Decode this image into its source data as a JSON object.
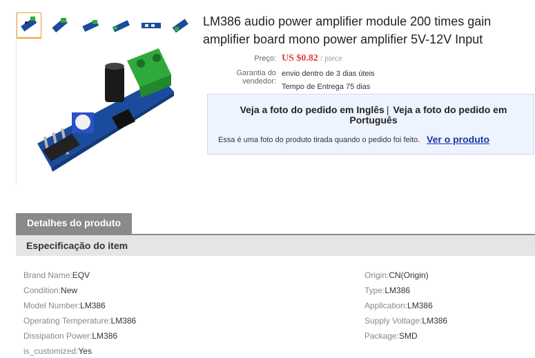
{
  "product": {
    "title": "LM386 audio power amplifier module 200 times gain amplifier board mono power amplifier 5V-12V Input"
  },
  "pricing": {
    "label": "Preço:",
    "price": "US $0.82",
    "unit": " / piece"
  },
  "guarantee": {
    "label": "Garantia do vendedor:",
    "line1": "envio dentro de 3 dias úteis",
    "line2": "Tempo de Entrega 75 dias"
  },
  "photo_box": {
    "link_english": "Veja a foto do pedido em Inglês",
    "separator": "|",
    "link_portuguese": "Veja a foto do pedido em Português",
    "note": "Essa é uma foto do produto tirada quando o pedido foi feito.",
    "view_product": "Ver o produto"
  },
  "tabs": [
    {
      "label": "Detalhes do produto"
    }
  ],
  "spec_section": {
    "title": "Especificação do item",
    "left": [
      {
        "key": "Brand Name:",
        "value": "EQV"
      },
      {
        "key": "Condition:",
        "value": "New"
      },
      {
        "key": "Model Number:",
        "value": "LM386"
      },
      {
        "key": "Operating Temperature:",
        "value": "LM386"
      },
      {
        "key": "Dissipation Power:",
        "value": "LM386"
      },
      {
        "key": "is_customized:",
        "value": "Yes"
      }
    ],
    "right": [
      {
        "key": "Origin:",
        "value": "CN(Origin)"
      },
      {
        "key": "Type:",
        "value": "LM386"
      },
      {
        "key": "Application:",
        "value": "LM386"
      },
      {
        "key": "Supply Voltage:",
        "value": "LM386"
      },
      {
        "key": "Package:",
        "value": "SMD"
      }
    ]
  },
  "colors": {
    "price": "#e4393c",
    "link": "#1a35a5",
    "tab": "#8a8a8a",
    "photo_box_bg": "#eef4ff",
    "board": "#1b4b9c",
    "terminal": "#2eaa3a"
  }
}
